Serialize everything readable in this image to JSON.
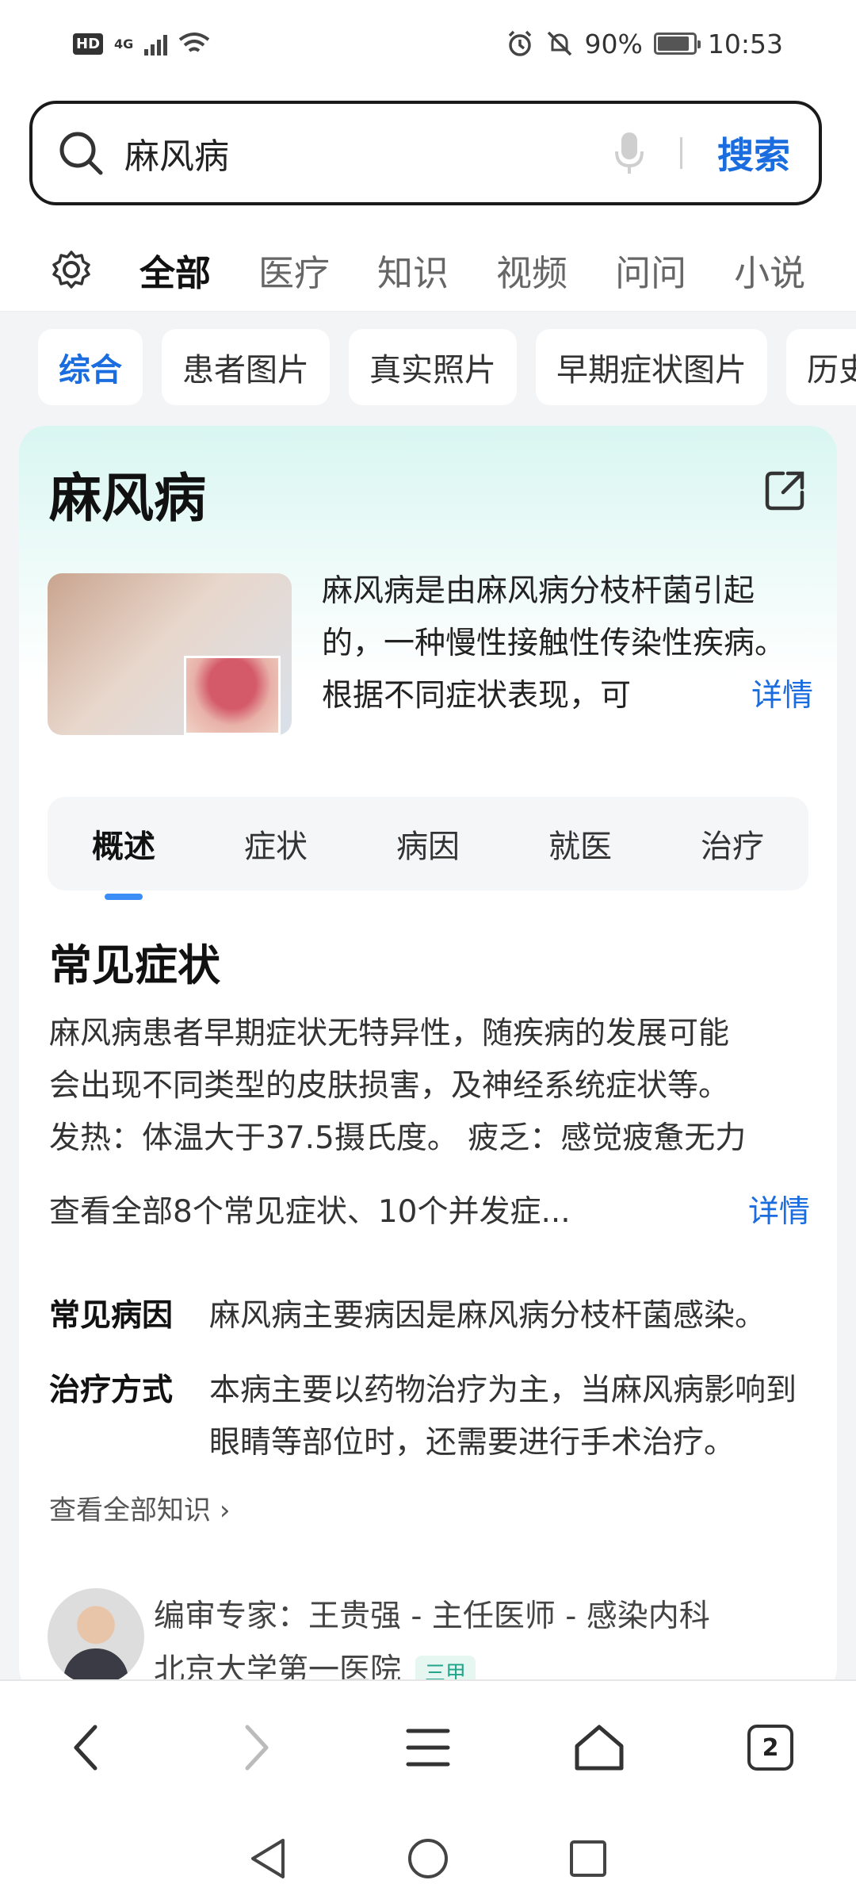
{
  "status_bar": {
    "network": "4G",
    "battery": "90%",
    "time": "10:53"
  },
  "search": {
    "query": "麻风病",
    "button": "搜索"
  },
  "top_tabs": [
    "全部",
    "医疗",
    "知识",
    "视频",
    "问问",
    "小说"
  ],
  "chips": [
    "综合",
    "患者图片",
    "真实照片",
    "早期症状图片",
    "历史"
  ],
  "card": {
    "title": "麻风病",
    "intro": "麻风病是由麻风病分枝杆菌引起的，一种慢性接触性传染性疾病。根据不同症状表现，可",
    "intro_more": "详情",
    "sub_tabs": [
      "概述",
      "症状",
      "病因",
      "就医",
      "治疗"
    ],
    "section_title": "常见症状",
    "section_lines": [
      "麻风病患者早期症状无特异性，随疾病的发展可能",
      "会出现不同类型的皮肤损害，及神经系统症状等。",
      "发热：体温大于37.5摄氏度。 疲乏：感觉疲惫无力"
    ],
    "section_more_text": "查看全部8个常见症状、10个并发症...",
    "section_more_link": "详情",
    "cause_label": "常见病因",
    "cause_value": "麻风病主要病因是麻风病分枝杆菌感染。",
    "treatment_label": "治疗方式",
    "treatment_value": "本病主要以药物治疗为主，当麻风病影响到眼睛等部位时，还需要进行手术治疗。",
    "all_knowledge": "查看全部知识",
    "expert_line1": "编审专家：王贵强 - 主任医师 - 感染内科",
    "expert_line2": "北京大学第一医院",
    "expert_badge": "三甲"
  },
  "bottom_nav": {
    "tab_count": "2"
  }
}
